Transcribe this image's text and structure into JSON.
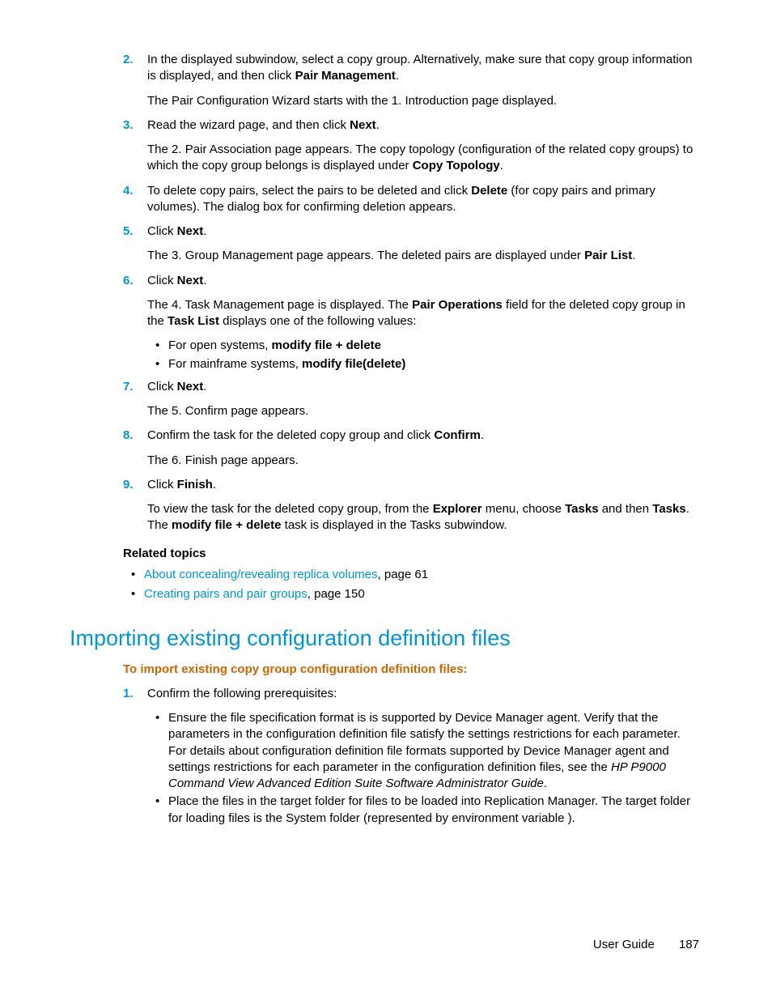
{
  "steps": [
    {
      "num": "2.",
      "parts": [
        {
          "segments": [
            {
              "t": "In the displayed subwindow, select a copy group. Alternatively, make sure that copy group information is displayed, and then click "
            },
            {
              "t": "Pair Management",
              "b": true
            },
            {
              "t": "."
            }
          ]
        },
        {
          "segments": [
            {
              "t": "The Pair Configuration Wizard starts with the 1. Introduction page displayed."
            }
          ]
        }
      ]
    },
    {
      "num": "3.",
      "parts": [
        {
          "segments": [
            {
              "t": "Read the wizard page, and then click "
            },
            {
              "t": "Next",
              "b": true
            },
            {
              "t": "."
            }
          ]
        },
        {
          "segments": [
            {
              "t": "The 2. Pair Association page appears. The copy topology (configuration of the related copy groups) to which the copy group belongs is displayed under "
            },
            {
              "t": "Copy Topology",
              "b": true
            },
            {
              "t": "."
            }
          ]
        }
      ]
    },
    {
      "num": "4.",
      "parts": [
        {
          "segments": [
            {
              "t": "To delete copy pairs, select the pairs to be deleted and click "
            },
            {
              "t": "Delete",
              "b": true
            },
            {
              "t": " (for copy pairs and primary volumes). The dialog box for confirming deletion appears."
            }
          ]
        }
      ]
    },
    {
      "num": "5.",
      "parts": [
        {
          "segments": [
            {
              "t": "Click "
            },
            {
              "t": "Next",
              "b": true
            },
            {
              "t": "."
            }
          ]
        },
        {
          "segments": [
            {
              "t": "The 3. Group Management page appears. The deleted pairs are displayed under "
            },
            {
              "t": "Pair List",
              "b": true
            },
            {
              "t": "."
            }
          ]
        }
      ]
    },
    {
      "num": "6.",
      "parts": [
        {
          "segments": [
            {
              "t": "Click "
            },
            {
              "t": "Next",
              "b": true
            },
            {
              "t": "."
            }
          ]
        },
        {
          "segments": [
            {
              "t": "The 4. Task Management page is displayed. The "
            },
            {
              "t": "Pair Operations",
              "b": true
            },
            {
              "t": " field for the deleted copy group in the "
            },
            {
              "t": "Task List",
              "b": true
            },
            {
              "t": " displays one of the following values:"
            }
          ]
        }
      ],
      "bullets": [
        {
          "segments": [
            {
              "t": "For open systems, "
            },
            {
              "t": "modify file + delete",
              "b": true
            }
          ]
        },
        {
          "segments": [
            {
              "t": "For mainframe systems, "
            },
            {
              "t": "modify file(delete)",
              "b": true
            }
          ]
        }
      ]
    },
    {
      "num": "7.",
      "parts": [
        {
          "segments": [
            {
              "t": "Click "
            },
            {
              "t": "Next",
              "b": true
            },
            {
              "t": "."
            }
          ]
        },
        {
          "segments": [
            {
              "t": "The 5. Confirm page appears."
            }
          ]
        }
      ]
    },
    {
      "num": "8.",
      "parts": [
        {
          "segments": [
            {
              "t": "Confirm the task for the deleted copy group and click "
            },
            {
              "t": "Confirm",
              "b": true
            },
            {
              "t": "."
            }
          ]
        },
        {
          "segments": [
            {
              "t": "The 6. Finish page appears."
            }
          ]
        }
      ]
    },
    {
      "num": "9.",
      "parts": [
        {
          "segments": [
            {
              "t": "Click "
            },
            {
              "t": "Finish",
              "b": true
            },
            {
              "t": "."
            }
          ]
        },
        {
          "segments": [
            {
              "t": "To view the task for the deleted copy group, from the "
            },
            {
              "t": "Explorer",
              "b": true
            },
            {
              "t": " menu, choose "
            },
            {
              "t": "Tasks",
              "b": true
            },
            {
              "t": " and then "
            },
            {
              "t": "Tasks",
              "b": true
            },
            {
              "t": ". The "
            },
            {
              "t": "modify file + delete",
              "b": true
            },
            {
              "t": "  task is displayed in the Tasks subwindow."
            }
          ]
        }
      ]
    }
  ],
  "related_heading": "Related topics",
  "related": [
    {
      "link": "About concealing/revealing replica volumes",
      "suffix": ", page 61"
    },
    {
      "link": "Creating pairs and pair groups",
      "suffix": ", page 150"
    }
  ],
  "section_heading": "Importing existing configuration definition files",
  "intro_line": "To import existing copy group configuration definition files:",
  "import_steps": [
    {
      "num": "1.",
      "parts": [
        {
          "segments": [
            {
              "t": "Confirm the following prerequisites:"
            }
          ]
        }
      ],
      "bullets": [
        {
          "segments": [
            {
              "t": "Ensure the file specification format is is supported by Device Manager agent. Verify that the parameters in the configuration definition file satisfy the settings restrictions for each parameter. For details about configuration definition file formats supported by Device Manager agent and settings restrictions for each parameter in the configuration definition files, see the "
            },
            {
              "t": "HP P9000 Command View Advanced Edition Suite Software Administrator Guide",
              "i": true
            },
            {
              "t": "."
            }
          ]
        },
        {
          "segments": [
            {
              "t": "Place the files in the target folder for files to be loaded into Replication Manager. The target folder for loading files is the System folder (represented by environment variable               )."
            }
          ]
        }
      ]
    }
  ],
  "footer_label": "User Guide",
  "footer_page": "187"
}
